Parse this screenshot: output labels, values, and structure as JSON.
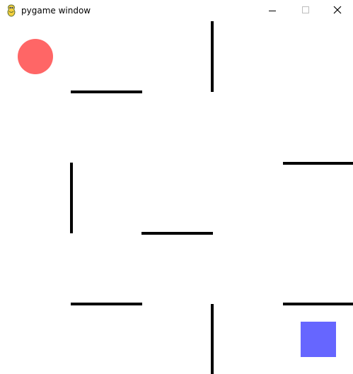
{
  "window": {
    "title": "pygame window",
    "icon": "pygame-snake-icon",
    "controls": {
      "minimize_icon": "minimize-icon",
      "maximize_icon": "maximize-icon",
      "close_icon": "close-icon"
    }
  },
  "game": {
    "background_color": "#ffffff",
    "wall_color": "#000000",
    "player": {
      "shape": "circle",
      "color": "#ff6666"
    },
    "goal": {
      "shape": "square",
      "color": "#6666ff"
    }
  }
}
